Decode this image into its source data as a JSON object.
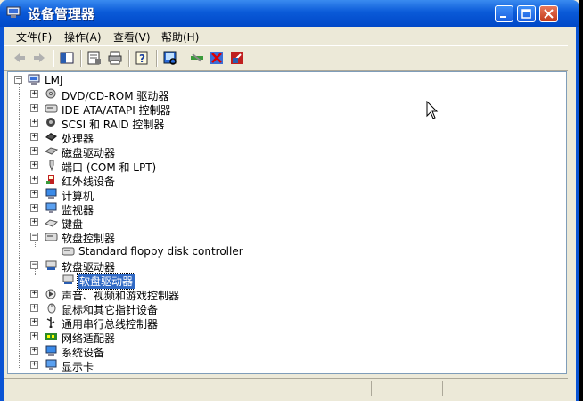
{
  "window": {
    "title": "设备管理器"
  },
  "menu": [
    "文件(F)",
    "操作(A)",
    "查看(V)",
    "帮助(H)"
  ],
  "toolbar": {
    "buttons": [
      "back-icon",
      "forward-icon",
      "show-hide-tree-icon",
      "properties-icon",
      "print-icon",
      "help-icon",
      "scan-hardware-icon",
      "update-driver-icon",
      "disable-device-icon",
      "uninstall-device-icon"
    ]
  },
  "tree": {
    "root": "LMJ",
    "items": [
      {
        "label": "DVD/CD-ROM 驱动器",
        "icon": "dvd-drive-icon",
        "expanded": false
      },
      {
        "label": "IDE ATA/ATAPI 控制器",
        "icon": "ide-controller-icon",
        "expanded": false
      },
      {
        "label": "SCSI 和 RAID 控制器",
        "icon": "scsi-controller-icon",
        "expanded": false
      },
      {
        "label": "处理器",
        "icon": "processor-icon",
        "expanded": false
      },
      {
        "label": "磁盘驱动器",
        "icon": "disk-drive-icon",
        "expanded": false
      },
      {
        "label": "端口 (COM 和 LPT)",
        "icon": "port-icon",
        "expanded": false
      },
      {
        "label": "红外线设备",
        "icon": "infrared-icon",
        "expanded": false
      },
      {
        "label": "计算机",
        "icon": "computer-icon",
        "expanded": false
      },
      {
        "label": "监视器",
        "icon": "monitor-icon",
        "expanded": false
      },
      {
        "label": "键盘",
        "icon": "keyboard-icon",
        "expanded": false
      },
      {
        "label": "软盘控制器",
        "icon": "floppy-controller-icon",
        "expanded": true,
        "children": [
          "Standard floppy disk controller"
        ]
      },
      {
        "label": "软盘驱动器",
        "icon": "floppy-drive-icon",
        "expanded": true,
        "children": [
          "软盘驱动器"
        ]
      },
      {
        "label": "声音、视频和游戏控制器",
        "icon": "sound-icon",
        "expanded": false
      },
      {
        "label": "鼠标和其它指针设备",
        "icon": "mouse-icon",
        "expanded": false
      },
      {
        "label": "通用串行总线控制器",
        "icon": "usb-icon",
        "expanded": false
      },
      {
        "label": "网络适配器",
        "icon": "network-adapter-icon",
        "expanded": false
      },
      {
        "label": "系统设备",
        "icon": "system-device-icon",
        "expanded": false
      },
      {
        "label": "显示卡",
        "icon": "display-adapter-icon",
        "expanded": false
      }
    ],
    "selected": "软盘驱动器"
  },
  "colors": {
    "title_bar": "#0a5ad8",
    "selection": "#316ac5",
    "window_bg": "#ece9d8"
  }
}
